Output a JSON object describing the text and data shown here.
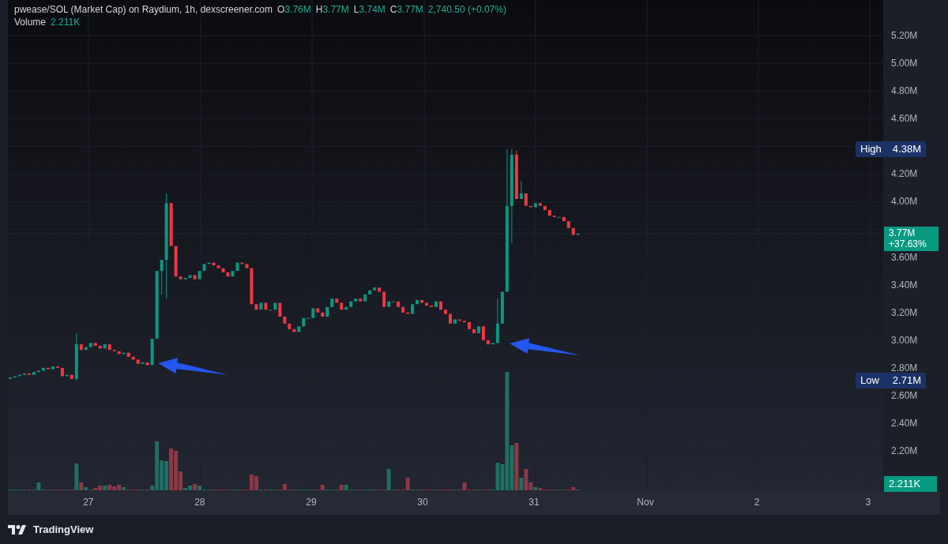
{
  "legend": {
    "title": "pwease/SOL (Market Cap) on Raydium, 1h, dexscreener.com",
    "values": [
      {
        "label": "O",
        "value": "3.76M"
      },
      {
        "label": "H",
        "value": "3.77M"
      },
      {
        "label": "L",
        "value": "3.74M"
      },
      {
        "label": "C",
        "value": "3.77M"
      }
    ],
    "change": "2,740.50 (+0.07%)",
    "volume_label": "Volume",
    "volume_value": "2.211K"
  },
  "price_axis": {
    "labels": [
      "5.20M",
      "5.00M",
      "4.80M",
      "4.60M",
      "4.20M",
      "4.00M",
      "3.60M",
      "3.40M",
      "3.20M",
      "3.00M",
      "2.80M",
      "2.60M",
      "2.40M",
      "2.20M"
    ]
  },
  "time_axis": {
    "labels": [
      "27",
      "28",
      "29",
      "30",
      "31",
      "Nov",
      "2",
      "3"
    ]
  },
  "price_badges": {
    "high_label": "High",
    "high_value": "4.38M",
    "low_label": "Low",
    "low_value": "2.71M",
    "last_value": "3.77M",
    "last_change": "+37.63%",
    "volume_value": "2.211K"
  },
  "footer": {
    "brand": "TradingView"
  }
}
